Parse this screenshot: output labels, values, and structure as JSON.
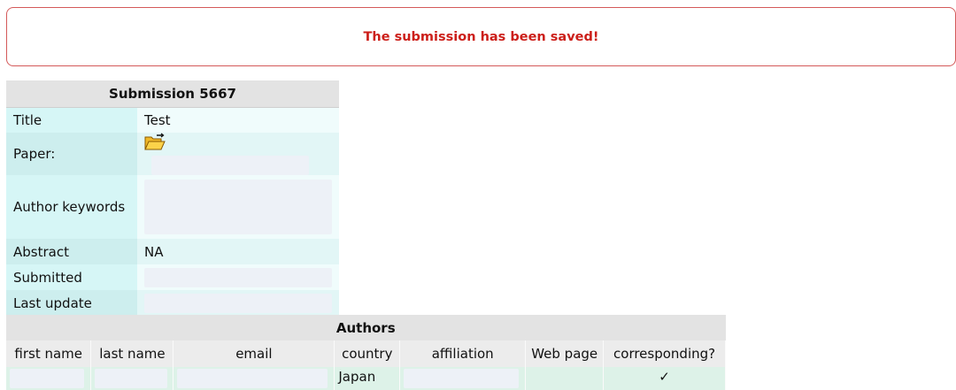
{
  "notice": {
    "message": "The submission has been saved!",
    "color": "#cc1f1a"
  },
  "submission": {
    "heading": "Submission 5667",
    "rows": [
      {
        "label": "Title",
        "value": "Test"
      },
      {
        "label": "Paper:",
        "value": "",
        "icon": "folder-open-icon"
      },
      {
        "label": "Author keywords",
        "value": ""
      },
      {
        "label": "Abstract",
        "value": "NA"
      },
      {
        "label": "Submitted",
        "value": ""
      },
      {
        "label": "Last update",
        "value": ""
      }
    ]
  },
  "authors": {
    "heading": "Authors",
    "columns": [
      "first name",
      "last name",
      "email",
      "country",
      "affiliation",
      "Web page",
      "corresponding?"
    ],
    "rows": [
      {
        "first_name": "",
        "last_name": "",
        "email": "",
        "country": "Japan",
        "affiliation": "",
        "web_page": "",
        "corresponding": "✓"
      }
    ]
  }
}
